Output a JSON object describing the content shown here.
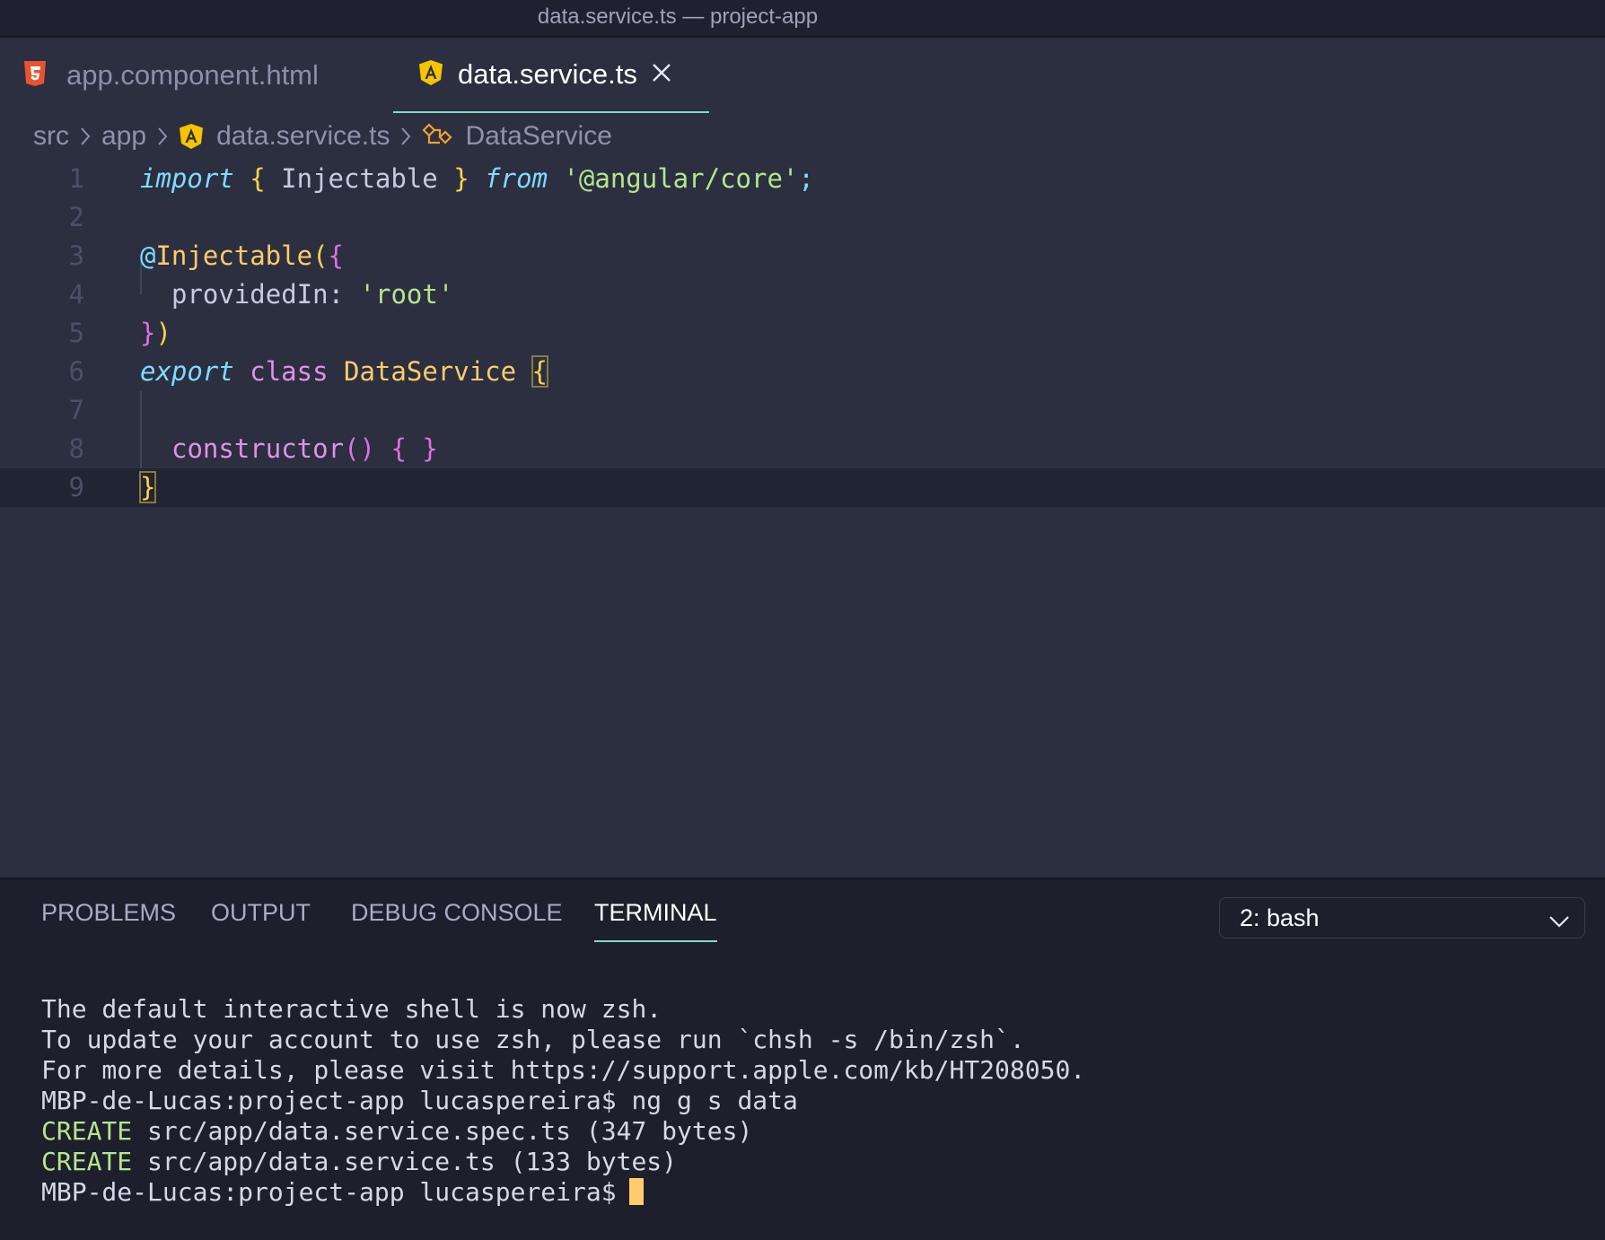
{
  "window": {
    "title": "data.service.ts — project-app"
  },
  "tabs": [
    {
      "label": "app.component.html",
      "icon": "html5-icon"
    },
    {
      "label": "data.service.ts",
      "icon": "angular-icon",
      "active": true
    }
  ],
  "breadcrumb": [
    "src",
    "app",
    "data.service.ts",
    "DataService"
  ],
  "editor": {
    "line_numbers": [
      "1",
      "2",
      "3",
      "4",
      "5",
      "6",
      "7",
      "8",
      "9"
    ],
    "tokens": {
      "l1": [
        "import",
        " ",
        "{",
        " Injectable ",
        "}",
        " ",
        "from",
        " ",
        "'@angular/core'",
        ";"
      ],
      "l3": [
        "@",
        "Injectable",
        "(",
        "{"
      ],
      "l4": [
        "providedIn:",
        " ",
        "'root'"
      ],
      "l5": [
        "}",
        ")"
      ],
      "l6": [
        "export",
        " ",
        "class",
        " ",
        "DataService",
        " ",
        "{"
      ],
      "l8": [
        "constructor",
        "()",
        " ",
        "{",
        " ",
        "}"
      ],
      "l9": [
        "}"
      ]
    }
  },
  "panel": {
    "tabs": [
      "PROBLEMS",
      "OUTPUT",
      "DEBUG CONSOLE",
      "TERMINAL"
    ],
    "active_tab": "TERMINAL",
    "terminal_select": "2: bash"
  },
  "terminal": {
    "line1": "The default interactive shell is now zsh.",
    "line2": "To update your account to use zsh, please run `chsh -s /bin/zsh`.",
    "line3": "For more details, please visit https://support.apple.com/kb/HT208050.",
    "line4": "MBP-de-Lucas:project-app lucaspereira$ ng g s data",
    "line5_tag": "CREATE",
    "line5_rest": " src/app/data.service.spec.ts (347 bytes)",
    "line6_tag": "CREATE",
    "line6_rest": " src/app/data.service.ts (133 bytes)",
    "prompt": "MBP-de-Lucas:project-app lucaspereira$"
  },
  "colors": {
    "accent": "#7fdbca",
    "html_icon": "#e8542f",
    "angular_icon": "#f5c400",
    "cursor": "#ffcb6b"
  }
}
